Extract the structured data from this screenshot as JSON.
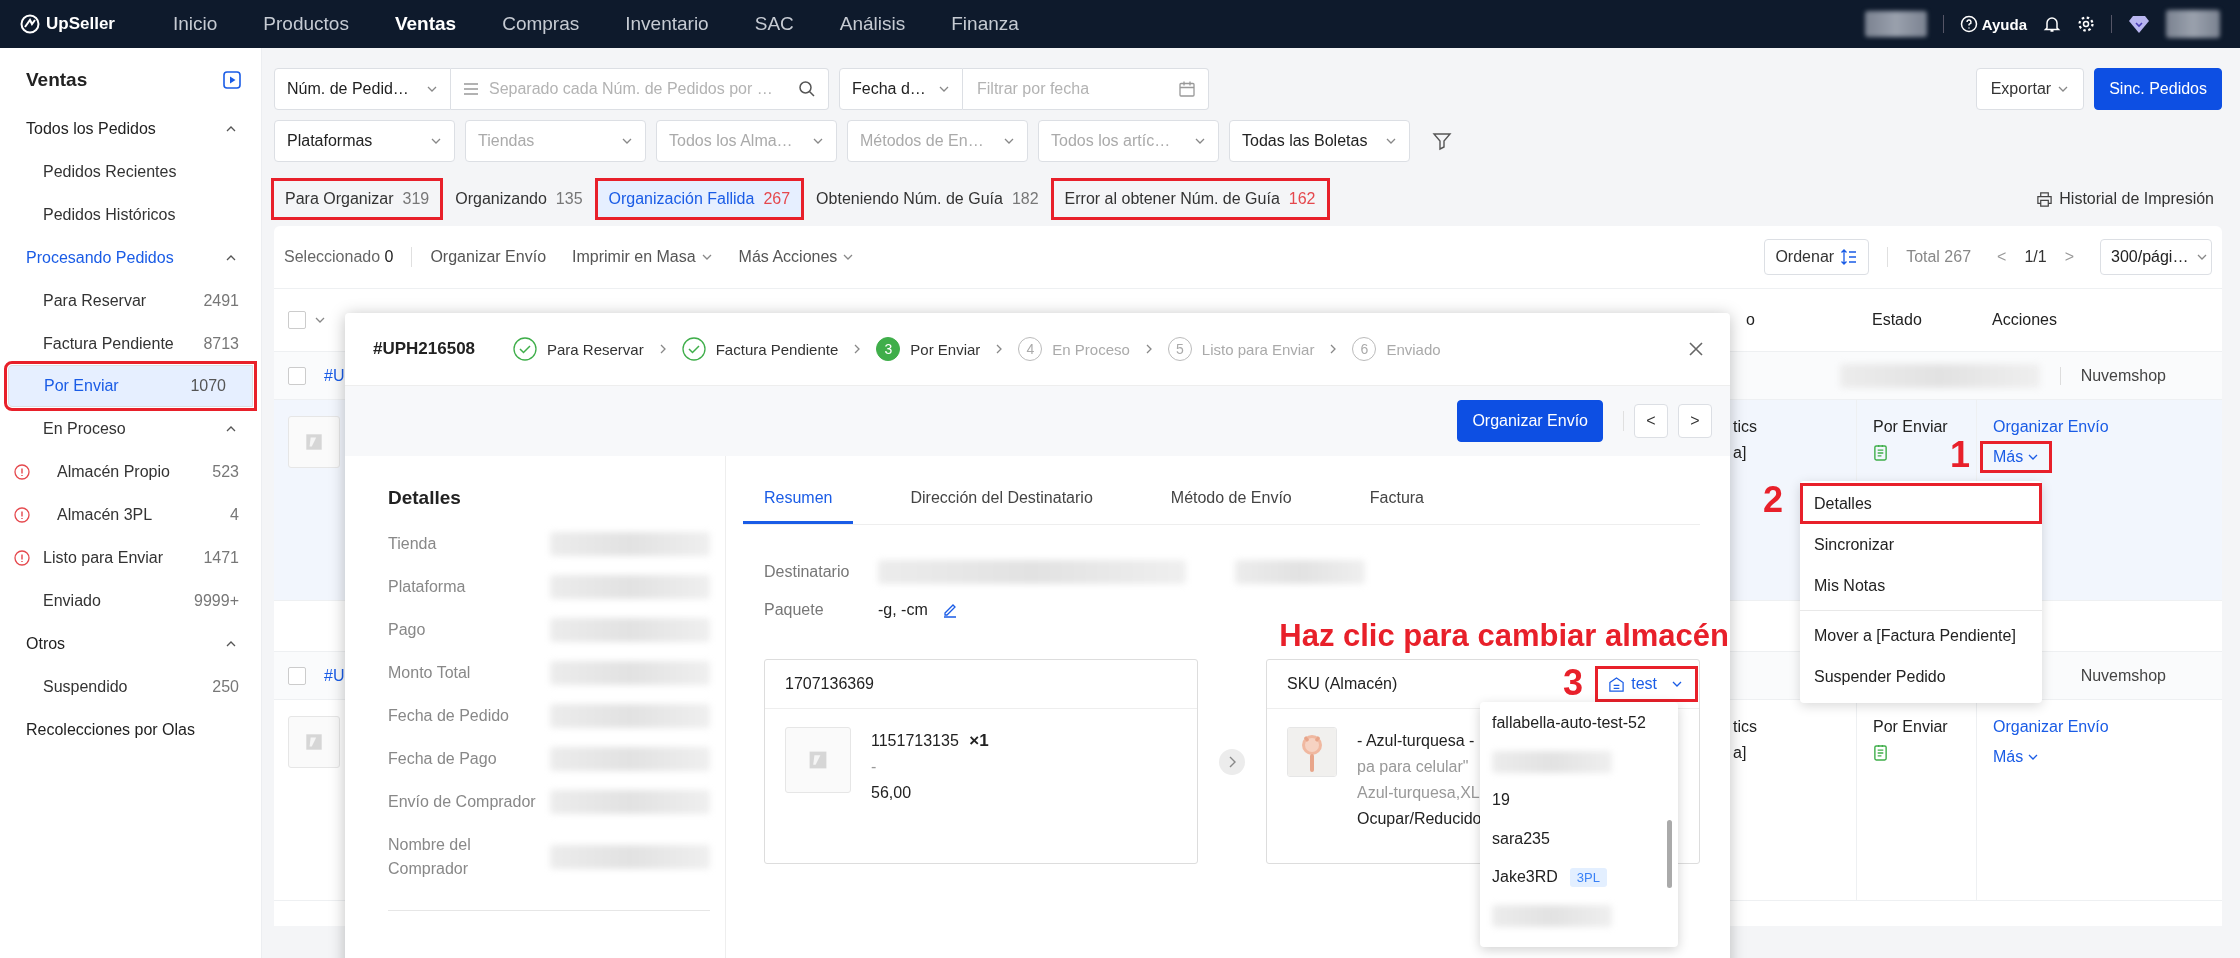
{
  "top_nav": {
    "logo": "UpSeller",
    "items": [
      {
        "label": "Inicio",
        "selected": false
      },
      {
        "label": "Productos",
        "selected": false
      },
      {
        "label": "Ventas",
        "selected": true
      },
      {
        "label": "Compras",
        "selected": false
      },
      {
        "label": "Inventario",
        "selected": false
      },
      {
        "label": "SAC",
        "selected": false
      },
      {
        "label": "Análisis",
        "selected": false
      },
      {
        "label": "Finanza",
        "selected": false
      }
    ],
    "help": "Ayuda"
  },
  "sidebar": {
    "title": "Ventas",
    "items": [
      {
        "label": "Todos los Pedidos",
        "selected": false,
        "expanded": true,
        "children": [
          {
            "label": "Pedidos Recientes",
            "selected": false,
            "warning": false,
            "annotated": false
          },
          {
            "label": "Pedidos Históricos",
            "selected": false,
            "warning": false,
            "annotated": false
          }
        ]
      },
      {
        "label": "Procesando Pedidos",
        "selected": true,
        "expanded": true,
        "children": [
          {
            "label": "Para Reservar",
            "count": "2491",
            "selected": false,
            "warning": false,
            "annotated": false
          },
          {
            "label": "Factura Pendiente",
            "count": "8713",
            "selected": false,
            "warning": false,
            "annotated": false
          },
          {
            "label": "Por Enviar",
            "count": "1070",
            "selected": true,
            "warning": false,
            "annotated": true
          },
          {
            "label": "En Proceso",
            "selected": false,
            "warning": false,
            "annotated": false,
            "expanded": true,
            "children": [
              {
                "label": "Almacén Propio",
                "count": "523",
                "selected": false,
                "warning": true,
                "annotated": false
              },
              {
                "label": "Almacén 3PL",
                "count": "4",
                "selected": false,
                "warning": true,
                "annotated": false
              }
            ]
          },
          {
            "label": "Listo para Enviar",
            "count": "1471",
            "selected": false,
            "warning": true,
            "annotated": false
          },
          {
            "label": "Enviado",
            "count": "9999+",
            "selected": false,
            "warning": false,
            "annotated": false
          }
        ]
      },
      {
        "label": "Otros",
        "selected": false,
        "expanded": true,
        "children": [
          {
            "label": "Suspendido",
            "count": "250",
            "selected": false,
            "warning": false,
            "annotated": false
          }
        ]
      },
      {
        "label": "Recolecciones por Olas",
        "selected": false
      }
    ]
  },
  "filters": {
    "order_search": {
      "field": "Núm. de Pedid…",
      "placeholder": "Separado cada Núm. de Pedidos por …"
    },
    "date_filter": {
      "field": "Fecha d…",
      "placeholder": "Filtrar por fecha"
    },
    "selects": [
      {
        "value": "Plataformas"
      },
      {
        "placeholder": "Tiendas"
      },
      {
        "placeholder": "Todos los Alma…"
      },
      {
        "placeholder": "Métodos de En…"
      },
      {
        "placeholder": "Todos los artíc…"
      },
      {
        "value": "Todas las Boletas"
      }
    ],
    "actions": [
      {
        "label": "Exportar",
        "kind": "menu"
      },
      {
        "label": "Sinc. Pedidos",
        "kind": "primary"
      }
    ]
  },
  "status_tabs": [
    {
      "label": "Para Organizar",
      "count": "319",
      "selected": false,
      "alert": false,
      "annotated": true
    },
    {
      "label": "Organizando",
      "count": "135",
      "selected": false,
      "alert": false,
      "annotated": false
    },
    {
      "label": "Organización Fallida",
      "count": "267",
      "selected": true,
      "alert": true,
      "annotated": true
    },
    {
      "label": "Obteniendo Núm. de Guía",
      "count": "182",
      "selected": false,
      "alert": false,
      "annotated": false
    },
    {
      "label": "Error al obtener Núm. de Guía",
      "count": "162",
      "selected": false,
      "alert": true,
      "annotated": true
    }
  ],
  "print_history": "Historial de Impresión",
  "toolbar": {
    "selected_label": "Seleccionado",
    "selected_count": "0",
    "actions": [
      {
        "label": "Organizar Envío",
        "menu": false
      },
      {
        "label": "Imprimir en Masa",
        "menu": true
      },
      {
        "label": "Más Acciones",
        "menu": true
      }
    ],
    "sort": "Ordenar",
    "total": "Total 267",
    "prev": "<",
    "page": "1/1",
    "next": ">",
    "page_size": "300/pági…"
  },
  "table": {
    "select_all_checked": false,
    "columns": [
      {
        "label": "o"
      },
      {
        "label": "Estado"
      },
      {
        "label": "Acciones"
      }
    ],
    "orders": [
      {
        "id": "#U",
        "checked": false,
        "store_blurred": true,
        "platform": "Nuvemshop",
        "highlighted": true,
        "info": [
          "tics",
          "a]"
        ],
        "status": "Por Enviar",
        "action": "Organizar Envío",
        "more": "Más",
        "more_annotated": true,
        "marker": "1"
      },
      {
        "id": "#U",
        "checked": false,
        "store_blurred": false,
        "platform": "Nuvemshop",
        "highlighted": false,
        "info": [
          "tics",
          "a]"
        ],
        "status": "Por Enviar",
        "action": "Organizar Envío",
        "more": "Más",
        "more_annotated": false
      }
    ]
  },
  "row_menu": {
    "groups": [
      {
        "items": [
          {
            "label": "Detalles",
            "annotated": true,
            "marker": "2"
          },
          {
            "label": "Sincronizar",
            "annotated": false
          },
          {
            "label": "Mis Notas",
            "annotated": false
          }
        ]
      },
      {
        "items": [
          {
            "label": "Mover a [Factura Pendiente]",
            "annotated": false
          },
          {
            "label": "Suspender Pedido",
            "annotated": false
          }
        ]
      }
    ]
  },
  "modal": {
    "order": "#UPH216508",
    "steps": [
      {
        "label": "Para Reservar",
        "done": true,
        "current": false
      },
      {
        "label": "Factura Pendiente",
        "done": true,
        "current": false
      },
      {
        "number": "3",
        "label": "Por Enviar",
        "done": false,
        "current": true
      },
      {
        "number": "4",
        "label": "En Proceso",
        "done": false,
        "current": false
      },
      {
        "number": "5",
        "label": "Listo para Enviar",
        "done": false,
        "current": false
      },
      {
        "number": "6",
        "label": "Enviado",
        "done": false,
        "current": false
      }
    ],
    "primary_action": "Organizar Envío",
    "prev": "<",
    "next": ">",
    "details": {
      "title": "Detalles",
      "fields": [
        {
          "label": "Tienda"
        },
        {
          "label": "Plataforma"
        },
        {
          "label": "Pago"
        },
        {
          "label": "Monto Total"
        },
        {
          "label": "Fecha de Pedido"
        },
        {
          "label": "Fecha de Pago"
        },
        {
          "label": "Envío de Comprador"
        },
        {
          "label": "Nombre del Comprador"
        }
      ]
    },
    "tabs": [
      {
        "label": "Resumen",
        "selected": true
      },
      {
        "label": "Dirección del Destinatario",
        "selected": false
      },
      {
        "label": "Método de Envío",
        "selected": false
      },
      {
        "label": "Factura",
        "selected": false
      }
    ],
    "recipient_label": "Destinatario",
    "package": {
      "label": "Paquete",
      "value": "-g, -cm"
    },
    "hint": "Haz clic para cambiar almacén",
    "source_card": {
      "title": "1707136369",
      "name": "1151713135",
      "quantity": "×1",
      "variant": "-",
      "price": "56,00"
    },
    "sku_card": {
      "title": "SKU (Almacén)",
      "warehouse": "test",
      "warehouse_annotated": true,
      "marker": "3",
      "lines": [
        {
          "text": "- Azul-turquesa -",
          "muted": false
        },
        {
          "text": "pa para celular\"",
          "muted": true
        },
        {
          "text": "Azul-turquesa,XL",
          "muted": true
        },
        {
          "text": "Ocupar/Reducido",
          "muted": false
        }
      ]
    },
    "warehouse_options": [
      {
        "kind": "text",
        "label": "fallabella-auto-test-52"
      },
      {
        "kind": "blurred"
      },
      {
        "kind": "text",
        "label": "19"
      },
      {
        "kind": "text",
        "label": "sara235"
      },
      {
        "kind": "text",
        "label": "Jake3RD",
        "tag": "3PL"
      },
      {
        "kind": "blurred"
      }
    ]
  }
}
